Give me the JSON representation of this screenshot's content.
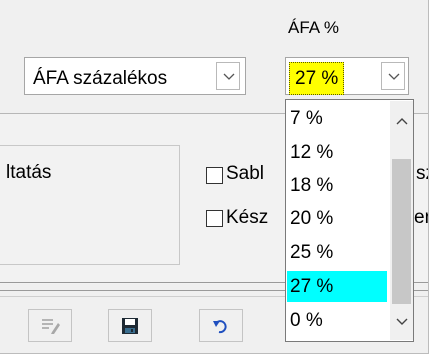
{
  "header": {
    "vat_label": "ÁFA %"
  },
  "vat_type_select": {
    "value": "ÁFA százalékos"
  },
  "vat_rate_select": {
    "value": "27 %",
    "highlight_color": "#ffff00",
    "options": [
      "7 %",
      "12 %",
      "18 %",
      "20 %",
      "25 %",
      "27 %",
      "0 %"
    ],
    "selected_index": 5,
    "selected_color": "#00ffff"
  },
  "service_group": {
    "label_fragment": "ltatás"
  },
  "checkboxes": [
    {
      "label": "Sabl",
      "suffix": "sz",
      "checked": false
    },
    {
      "label": "Kész",
      "suffix": "en",
      "checked": false
    }
  ],
  "toolbar": {
    "icons": [
      "edit-list-icon",
      "floppy-disk-icon",
      "undo-arrow-icon"
    ]
  }
}
